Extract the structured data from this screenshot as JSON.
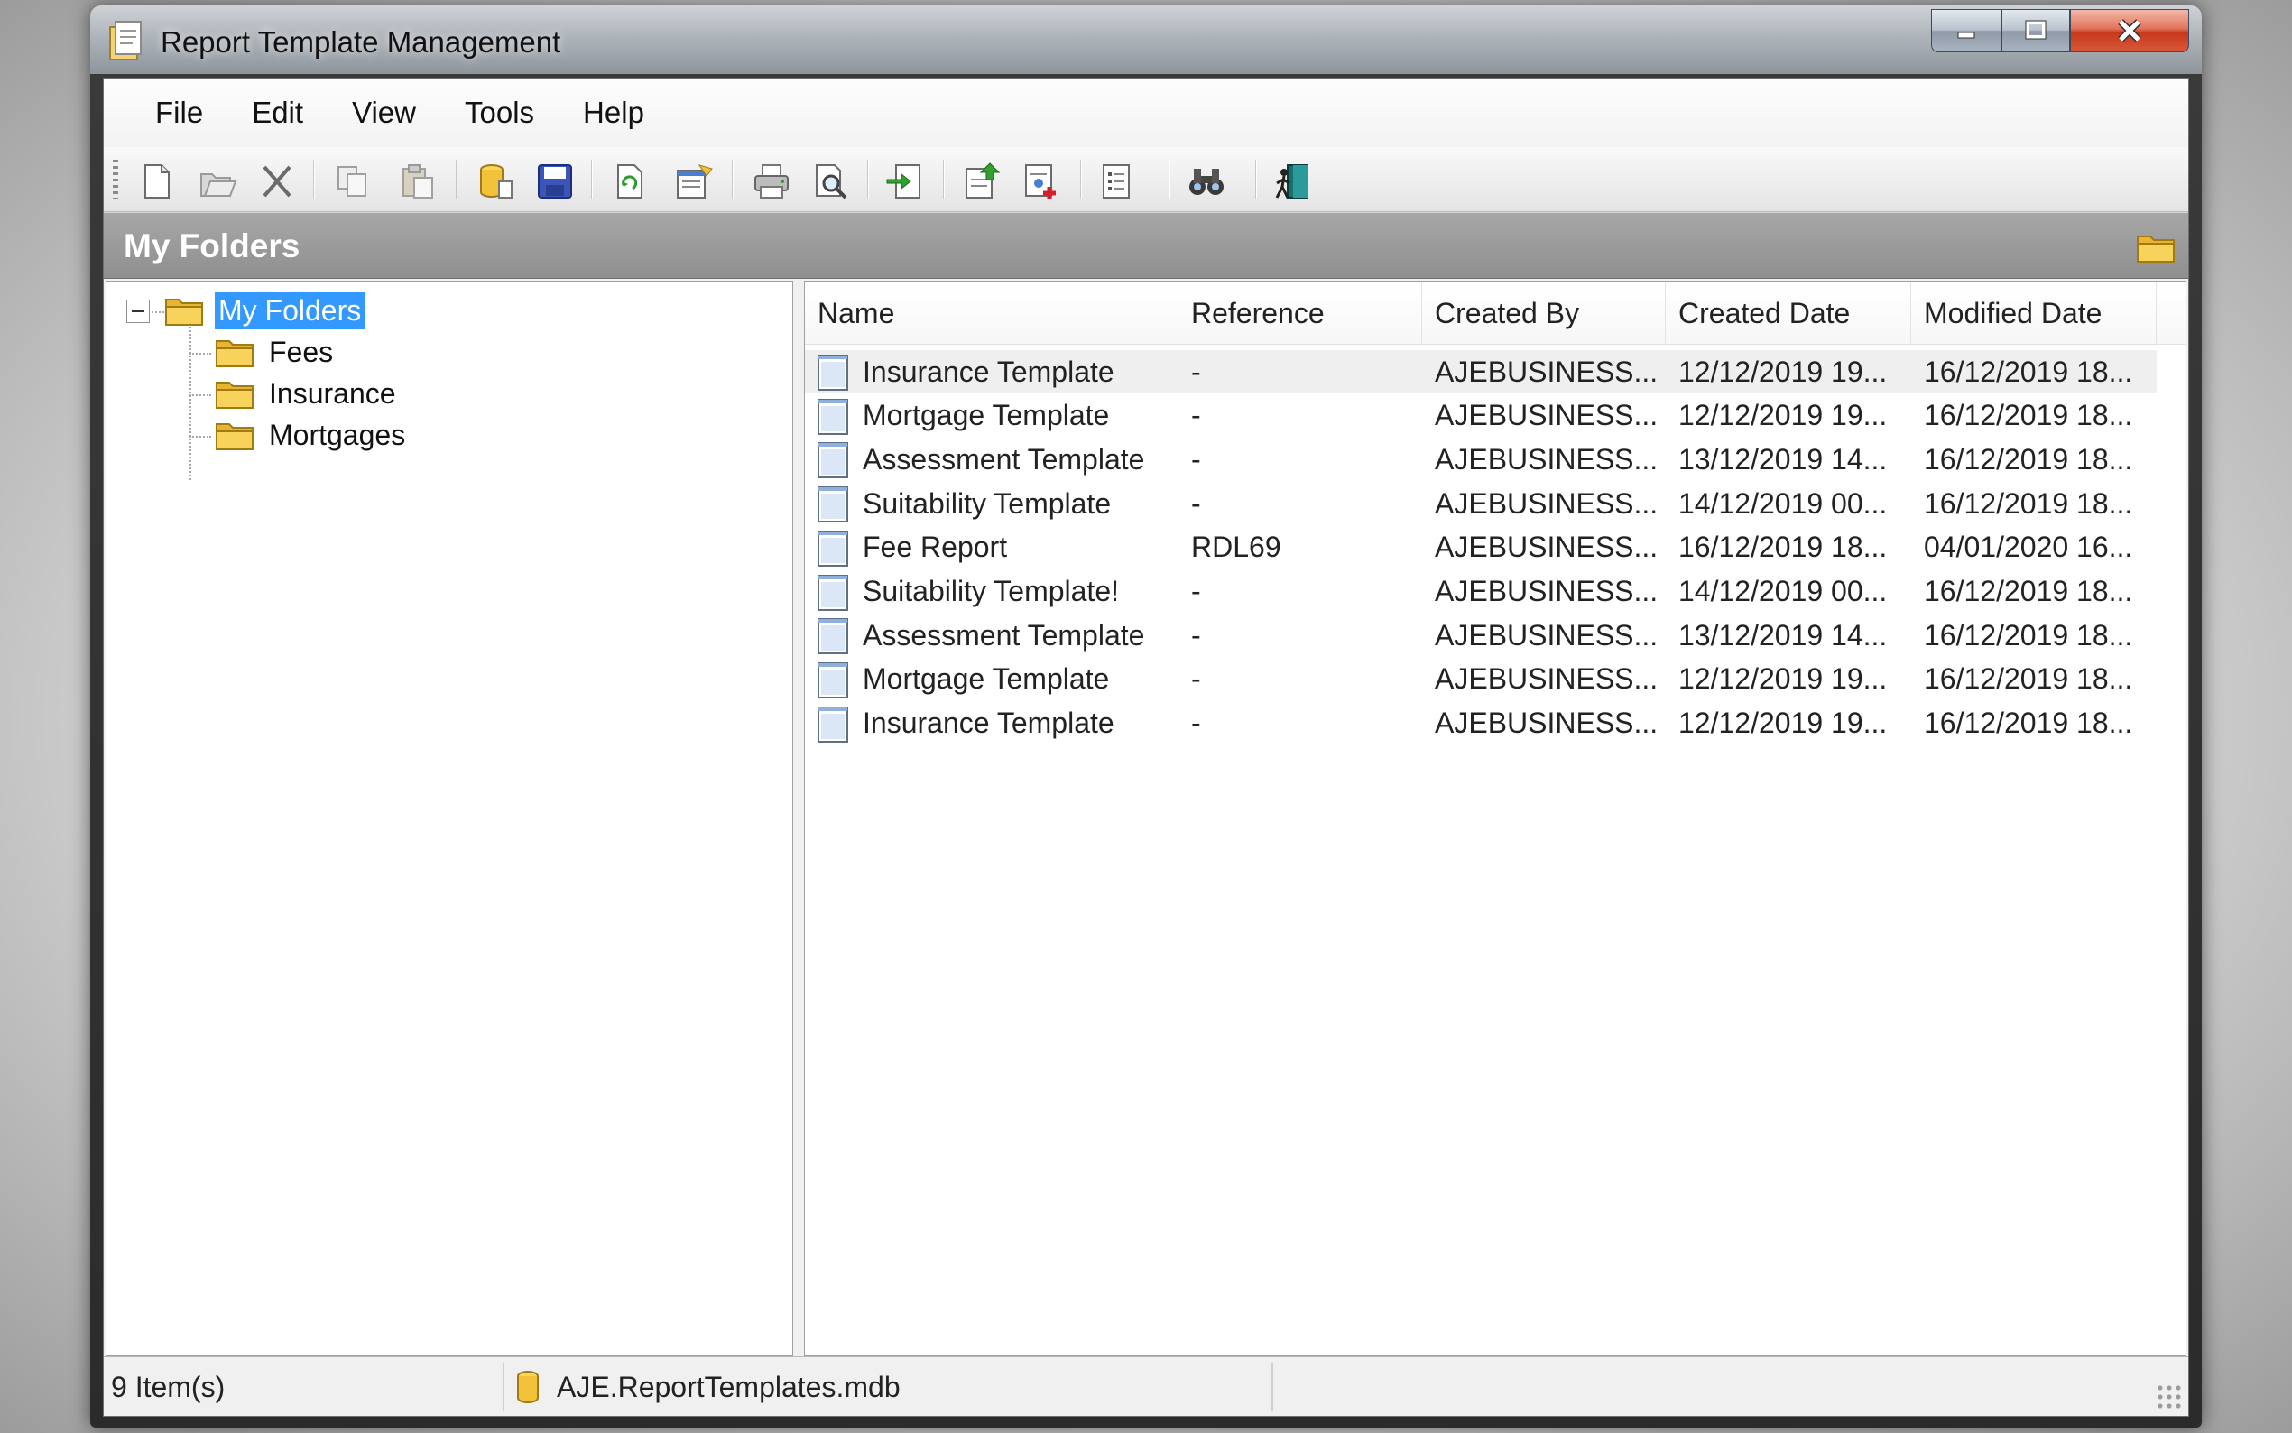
{
  "window": {
    "title": "Report Template Management"
  },
  "menu": [
    "File",
    "Edit",
    "View",
    "Tools",
    "Help"
  ],
  "toolbar": {
    "buttons": [
      {
        "name": "new-icon"
      },
      {
        "name": "open-icon"
      },
      {
        "name": "delete-icon"
      },
      {
        "name": "copy-icon"
      },
      {
        "name": "paste-icon"
      },
      {
        "name": "database-icon"
      },
      {
        "name": "save-icon"
      },
      {
        "name": "refresh-icon"
      },
      {
        "name": "properties-icon"
      },
      {
        "name": "print-icon"
      },
      {
        "name": "print-preview-icon"
      },
      {
        "name": "import-icon"
      },
      {
        "name": "export-icon"
      },
      {
        "name": "add-report-icon"
      },
      {
        "name": "report-details-icon"
      },
      {
        "name": "find-icon"
      },
      {
        "name": "exit-icon"
      }
    ]
  },
  "header": {
    "title": "My Folders"
  },
  "tree": {
    "root": "My Folders",
    "children": [
      "Fees",
      "Insurance",
      "Mortgages"
    ]
  },
  "list": {
    "columns": [
      "Name",
      "Reference",
      "Created By",
      "Created Date",
      "Modified Date"
    ],
    "rows": [
      {
        "name": "Insurance Template",
        "reference": "-",
        "created_by": "AJEBUSINESS...",
        "created": "12/12/2019 19...",
        "modified": "16/12/2019 18..."
      },
      {
        "name": "Mortgage Template",
        "reference": "-",
        "created_by": "AJEBUSINESS...",
        "created": "12/12/2019 19...",
        "modified": "16/12/2019 18..."
      },
      {
        "name": "Assessment Template",
        "reference": "-",
        "created_by": "AJEBUSINESS...",
        "created": "13/12/2019 14...",
        "modified": "16/12/2019 18..."
      },
      {
        "name": "Suitability Template",
        "reference": "-",
        "created_by": "AJEBUSINESS...",
        "created": "14/12/2019 00...",
        "modified": "16/12/2019 18..."
      },
      {
        "name": "Fee Report",
        "reference": "RDL69",
        "created_by": "AJEBUSINESS...",
        "created": "16/12/2019 18...",
        "modified": "04/01/2020 16..."
      },
      {
        "name": "Suitability Template!",
        "reference": "-",
        "created_by": "AJEBUSINESS...",
        "created": "14/12/2019 00...",
        "modified": "16/12/2019 18..."
      },
      {
        "name": "Assessment Template",
        "reference": "-",
        "created_by": "AJEBUSINESS...",
        "created": "13/12/2019 14...",
        "modified": "16/12/2019 18..."
      },
      {
        "name": "Mortgage Template",
        "reference": "-",
        "created_by": "AJEBUSINESS...",
        "created": "12/12/2019 19...",
        "modified": "16/12/2019 18..."
      },
      {
        "name": "Insurance Template",
        "reference": "-",
        "created_by": "AJEBUSINESS...",
        "created": "12/12/2019 19...",
        "modified": "16/12/2019 18..."
      }
    ]
  },
  "status": {
    "count": "9 Item(s)",
    "database": "AJE.ReportTemplates.mdb"
  },
  "colors": {
    "selection": "#3399ff",
    "header_band": "#9a9a9a",
    "folder_yellow": "#f3c94a"
  }
}
